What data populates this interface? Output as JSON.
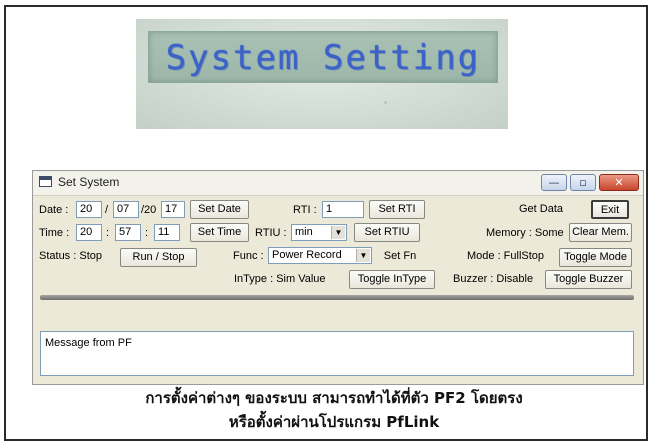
{
  "lcd": {
    "text": "System Setting"
  },
  "window": {
    "title": "Set System",
    "controls": {
      "minimize": "—",
      "maximize": "▫",
      "close": "✕"
    }
  },
  "date": {
    "label": "Date :",
    "day": "20",
    "sep1": "/",
    "month": "07",
    "sep2": "/20",
    "year": "17",
    "button": "Set Date"
  },
  "time": {
    "label": "Time :",
    "hour": "20",
    "sep1": ":",
    "minute": "57",
    "sep2": ":",
    "second": "11",
    "button": "Set Time"
  },
  "status": {
    "label": "Status : Stop",
    "button": "Run / Stop"
  },
  "rti": {
    "label": "RTI :",
    "value": "1",
    "button": "Set RTI"
  },
  "rtiu": {
    "label": "RTIU :",
    "value": "min",
    "button": "Set RTIU"
  },
  "func": {
    "label": "Func :",
    "value": "Power Record",
    "button": "Set Fn"
  },
  "intype": {
    "label": "InType : Sim Value",
    "button": "Toggle InType"
  },
  "get_data": {
    "button": "Get Data"
  },
  "exit": {
    "button": "Exit"
  },
  "memory": {
    "label": "Memory : Some",
    "button": "Clear Mem."
  },
  "mode": {
    "label": "Mode : FullStop",
    "button": "Toggle Mode"
  },
  "buzzer": {
    "label": "Buzzer : Disable",
    "button": "Toggle Buzzer"
  },
  "message": {
    "text": "Message from PF"
  },
  "caption": {
    "line1": "การตั้งค่าต่างๆ ของระบบ สามารถทำได้ที่ตัว PF2 โดยตรง",
    "line2": "หรือตั้งค่าผ่านโปรแกรม PfLink"
  },
  "colors": {
    "lcd_text": "#3c62c9",
    "lcd_bg": "#a8c1b4",
    "window_bg": "#ece9d8",
    "close_button": "#c8452c"
  },
  "icons": {
    "window_icon": "window-icon",
    "dropdown": "chevron-down-icon"
  }
}
